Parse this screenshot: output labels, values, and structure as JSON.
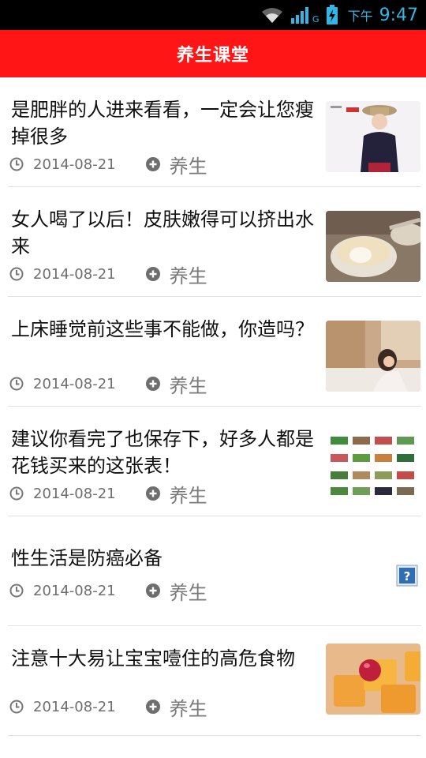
{
  "status_bar": {
    "carrier": "G",
    "ampm": "下午",
    "time": "9:47",
    "accent": "#33b5e5"
  },
  "header": {
    "title": "养生课堂",
    "color": "#ff1515"
  },
  "articles": [
    {
      "title": "是肥胖的人进来看看，一定会让您瘦掉很多",
      "date": "2014-08-21",
      "tag": "养生",
      "image": "photo-woman-in-hat"
    },
    {
      "title": "女人喝了以后！皮肤嫩得可以挤出水来",
      "date": "2014-08-21",
      "tag": "养生",
      "image": "photo-dessert-bowl"
    },
    {
      "title": "上床睡觉前这些事不能做，你造吗？",
      "date": "2014-08-21",
      "tag": "养生",
      "image": "photo-woman-on-bed"
    },
    {
      "title": "建议你看完了也保存下，好多人都是花钱买来的这张表！",
      "date": "2014-08-21",
      "tag": "养生",
      "image": "food-chart-table"
    },
    {
      "title": "性生活是防癌必备",
      "date": "2014-08-21",
      "tag": "养生",
      "image": "missing-image-icon"
    },
    {
      "title": "注意十大易让宝宝噎住的高危食物",
      "date": "2014-08-21",
      "tag": "养生",
      "image": "photo-fruit-dessert"
    }
  ]
}
